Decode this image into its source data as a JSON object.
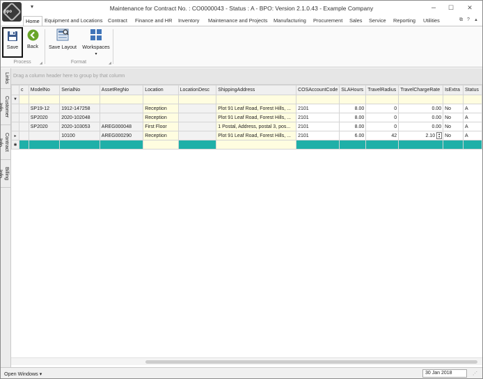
{
  "window": {
    "title": "Maintenance for Contract No. : CO0000043 - Status : A - BPO: Version 2.1.0.43 - Example Company",
    "logo_text": "bpo",
    "qat_arrow": "▾",
    "minimize": "–",
    "maximize": "☐",
    "close": "✕"
  },
  "ribbon": {
    "tabs": [
      "Home",
      "Equipment and Locations",
      "Contract",
      "Finance and HR",
      "Inventory",
      "Maintenance and Projects",
      "Manufacturing",
      "Procurement",
      "Sales",
      "Service",
      "Reporting",
      "Utilities"
    ],
    "active_tab": "Home",
    "help_icons": [
      "⧉",
      "?",
      "▲"
    ],
    "buttons": {
      "save": "Save",
      "back": "Back",
      "save_layout": "Save Layout",
      "workspaces": "Workspaces",
      "workspaces_arrow": "▾"
    },
    "groups": {
      "process": "Process",
      "format": "Format"
    },
    "launcher": "◢"
  },
  "sidebar": {
    "tabs": [
      "Links",
      "Customer Info",
      "Contract Info",
      "Billing Info"
    ]
  },
  "grid": {
    "group_hint": "Drag a column header here to group by that column",
    "columns": [
      "c",
      "ModelNo",
      "SerialNo",
      "AssetRegNo",
      "Location",
      "LocationDesc",
      "ShippingAddress",
      "COSAccountCode",
      "SLAHours",
      "TravelRadius",
      "TravelChargeRate",
      "IsExtra",
      "Status"
    ],
    "filter_icon": "▼",
    "rows": [
      {
        "indicator": "",
        "c": "",
        "ModelNo": "SP19-12",
        "SerialNo": "1912-147258",
        "AssetRegNo": "",
        "Location": "Reception",
        "LocationDesc": "",
        "ShippingAddress": "Plot 91 Leaf Road, Forest Hills, ...",
        "COSAccountCode": "2101",
        "SLAHours": "8.00",
        "TravelRadius": "0",
        "TravelChargeRate": "0.00",
        "IsExtra": "No",
        "Status": "A"
      },
      {
        "indicator": "",
        "c": "",
        "ModelNo": "SP2020",
        "SerialNo": "2020-102048",
        "AssetRegNo": "",
        "Location": "Reception",
        "LocationDesc": "",
        "ShippingAddress": "Plot 91 Leaf Road, Forest Hills, ...",
        "COSAccountCode": "2101",
        "SLAHours": "8.00",
        "TravelRadius": "0",
        "TravelChargeRate": "0.00",
        "IsExtra": "No",
        "Status": "A"
      },
      {
        "indicator": "",
        "c": "",
        "ModelNo": "SP2020",
        "SerialNo": "2020-103053",
        "AssetRegNo": "AREG000048",
        "Location": "First Floor",
        "LocationDesc": "",
        "ShippingAddress": "1 Postal, Address, postal 3, pos...",
        "COSAccountCode": "2101",
        "SLAHours": "8.00",
        "TravelRadius": "0",
        "TravelChargeRate": "0.00",
        "IsExtra": "No",
        "Status": "A"
      },
      {
        "indicator": "▸",
        "c": "",
        "ModelNo": "",
        "SerialNo": "10100",
        "AssetRegNo": "AREG000290",
        "Location": "Reception",
        "LocationDesc": "",
        "ShippingAddress": "Plot 91 Leaf Road, Forest Hills, ...",
        "COSAccountCode": "2101",
        "SLAHours": "6.00",
        "TravelRadius": "42",
        "TravelChargeRate": "2.10",
        "IsExtra": "No",
        "Status": "A"
      }
    ],
    "new_row_indicator": "✱",
    "spin_up": "▲",
    "spin_down": "▼"
  },
  "statusbar": {
    "open_windows": "Open Windows ▾",
    "date": "30 Jan 2018",
    "resize_grip": "⋰"
  },
  "colors": {
    "new_row": "#1fb0a8",
    "filter_row": "#fffde0",
    "save_icon": "#3b5a8c",
    "back_icon": "#6aa52a"
  }
}
